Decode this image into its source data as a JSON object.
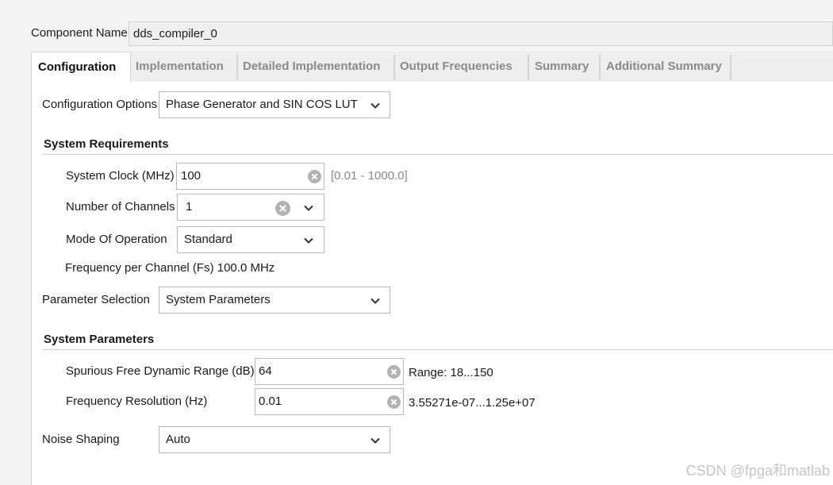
{
  "component_name": {
    "label": "Component Name",
    "value": "dds_compiler_0"
  },
  "tabs": [
    {
      "label": "Configuration",
      "active": true
    },
    {
      "label": "Implementation",
      "active": false
    },
    {
      "label": "Detailed Implementation",
      "active": false
    },
    {
      "label": "Output Frequencies",
      "active": false
    },
    {
      "label": "Summary",
      "active": false
    },
    {
      "label": "Additional Summary",
      "active": false
    }
  ],
  "configuration_options": {
    "label": "Configuration Options",
    "value": "Phase Generator and SIN COS LUT"
  },
  "system_requirements": {
    "heading": "System Requirements",
    "system_clock": {
      "label": "System Clock (MHz)",
      "value": "100",
      "range": "[0.01 - 1000.0]"
    },
    "num_channels": {
      "label": "Number of Channels",
      "value": "1"
    },
    "mode_of_operation": {
      "label": "Mode Of Operation",
      "value": "Standard"
    },
    "freq_per_channel": "Frequency per Channel (Fs) 100.0 MHz"
  },
  "parameter_selection": {
    "label": "Parameter Selection",
    "value": "System Parameters"
  },
  "system_parameters": {
    "heading": "System Parameters",
    "sfdr": {
      "label": "Spurious Free Dynamic Range (dB)",
      "value": "64",
      "range": "Range: 18...150"
    },
    "freq_resolution": {
      "label": "Frequency Resolution (Hz)",
      "value": "0.01",
      "range": "3.55271e-07...1.25e+07"
    }
  },
  "noise_shaping": {
    "label": "Noise Shaping",
    "value": "Auto"
  },
  "watermark": "CSDN @fpga和matlab",
  "colors": {
    "panel": "#ffffff",
    "background": "#f4f4f4",
    "tab_inactive": "#8a8a8a",
    "border": "#b9b9b9"
  }
}
